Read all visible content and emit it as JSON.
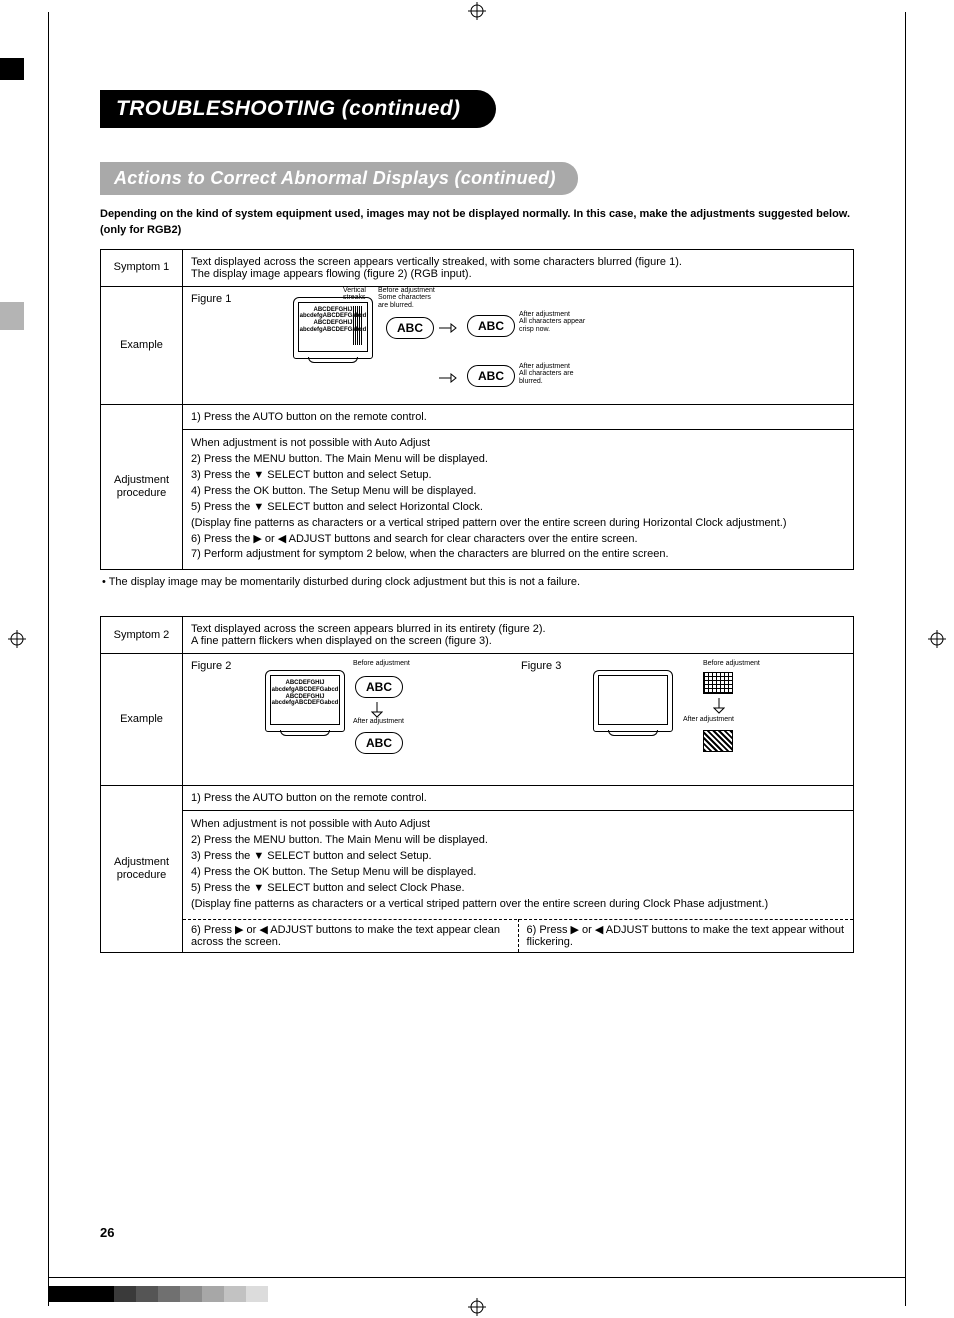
{
  "title": "TROUBLESHOOTING (continued)",
  "subtitle": "Actions to Correct Abnormal Displays (continued)",
  "intro": "Depending on the kind of system equipment used, images may not be displayed normally.  In this case, make the adjustments suggested below. (only for RGB2)",
  "symptom1": {
    "label": "Symptom 1",
    "text": "Text displayed across the screen appears vertically streaked, with some characters blurred (figure 1).\nThe display image appears flowing (figure 2) (RGB input).",
    "example_label": "Example",
    "figure1_label": "Figure 1",
    "vstreaks_label": "Vertical\nstreaks",
    "before_label": "Before adjustment\nSome characters\nare blurred.",
    "after_ok_label": "After adjustment\nAll characters appear\ncrisp now.",
    "after_bad_label": "After adjustment\nAll characters are\nblurred.",
    "screen_lines": [
      "ABCDEFGHIJ",
      "abcdefgABCDEFGabcd",
      "ABCDEFGHIJ",
      "abcdefgABCDEFGabcd"
    ],
    "adjust_label": "Adjustment\nprocedure",
    "step1": "1) Press the AUTO button on the remote control.",
    "steps": [
      "When adjustment is not possible with Auto Adjust",
      "2) Press the MENU button. The Main Menu will be displayed.",
      "3) Press the ▼ SELECT button and select Setup.",
      "4) Press the OK button. The Setup Menu will be displayed.",
      "5) Press the ▼ SELECT button and select Horizontal Clock.",
      "(Display fine patterns as characters or a vertical striped pattern over the entire screen during Horizontal Clock adjustment.)",
      "6) Press the ▶ or ◀ ADJUST buttons and search for clear characters over the entire screen.",
      "7) Perform adjustment for symptom 2 below, when the characters are blurred on the entire screen."
    ],
    "note": "• The display image may be momentarily disturbed during clock adjustment but this is not a failure."
  },
  "symptom2": {
    "label": "Symptom 2",
    "text": "Text displayed across the screen appears blurred in its entirety (figure 2).\nA fine pattern flickers when displayed on the screen (figure 3).",
    "example_label": "Example",
    "figure2_label": "Figure 2",
    "figure3_label": "Figure 3",
    "before_label": "Before adjustment",
    "after_label": "After adjustment",
    "screen_lines": [
      "ABCDEFGHIJ",
      "abcdefgABCDEFGabcd",
      "ABCDEFGHIJ",
      "abcdefgABCDEFGabcd"
    ],
    "adjust_label": "Adjustment\nprocedure",
    "step1": "1) Press the AUTO button on the remote control.",
    "steps": [
      "When adjustment is not possible with Auto Adjust",
      "2) Press the MENU button. The Main Menu will be displayed.",
      "3) Press the ▼ SELECT button and select Setup.",
      "4) Press the OK button. The Setup Menu will be displayed.",
      "5) Press the ▼ SELECT button and select Clock Phase.",
      "(Display fine patterns as characters or a vertical striped pattern over the entire screen during Clock Phase adjustment.)"
    ],
    "step6a": "6) Press ▶ or ◀ ADJUST buttons to make the text appear clean across the screen.",
    "step6b": "6) Press ▶ or ◀ ADJUST buttons to make the text appear without flickering."
  },
  "abc": "ABC",
  "page_number": "26",
  "footer_colors": [
    "#000000",
    "#000000",
    "#000000",
    "#3a3a3a",
    "#555555",
    "#707070",
    "#8c8c8c",
    "#a7a7a7",
    "#c2c2c2",
    "#dcdcdc"
  ]
}
